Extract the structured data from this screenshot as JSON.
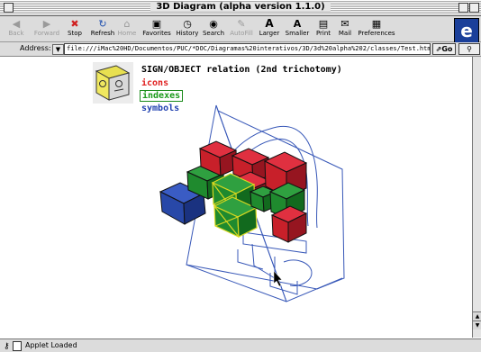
{
  "window": {
    "title": "3D Diagram (alpha version 1.1.0)"
  },
  "toolbar": {
    "buttons": [
      {
        "label": "Back",
        "icon": "back-arrow-icon",
        "enabled": false
      },
      {
        "label": "Forward",
        "icon": "forward-arrow-icon",
        "enabled": false
      },
      {
        "label": "Stop",
        "icon": "stop-icon",
        "enabled": true
      },
      {
        "label": "Refresh",
        "icon": "refresh-icon",
        "enabled": true
      },
      {
        "label": "Home",
        "icon": "home-icon",
        "enabled": false
      },
      {
        "label": "Favorites",
        "icon": "favorites-icon",
        "enabled": true
      },
      {
        "label": "History",
        "icon": "history-icon",
        "enabled": true
      },
      {
        "label": "Search",
        "icon": "search-icon",
        "enabled": true
      },
      {
        "label": "AutoFill",
        "icon": "autofill-icon",
        "enabled": false
      },
      {
        "label": "Larger",
        "icon": "larger-text-icon",
        "enabled": true
      },
      {
        "label": "Smaller",
        "icon": "smaller-text-icon",
        "enabled": true
      },
      {
        "label": "Print",
        "icon": "print-icon",
        "enabled": true
      },
      {
        "label": "Mail",
        "icon": "mail-icon",
        "enabled": true
      },
      {
        "label": "Preferences",
        "icon": "preferences-icon",
        "enabled": true
      }
    ],
    "browser_logo": "e"
  },
  "address": {
    "label": "Address:",
    "value": "file:///iMac%20HD/Documentos/PUC/*DOC/Diagramas%20interativos/3D/3d%20alpha%202/classes/Test.html",
    "go_label": "Go"
  },
  "page": {
    "heading": "SIGN/OBJECT relation (2nd trichotomy)",
    "legend": [
      {
        "label": "icons",
        "color": "#e02020"
      },
      {
        "label": "indexes",
        "color": "#1b9a1b"
      },
      {
        "label": "symbols",
        "color": "#2040b0"
      }
    ]
  },
  "status": {
    "text": "Applet Loaded"
  },
  "colors": {
    "red_cube": "#c8202a",
    "green_cube": "#1f8a2e",
    "blue_cube": "#2848a8",
    "wire": "#3858b8"
  }
}
